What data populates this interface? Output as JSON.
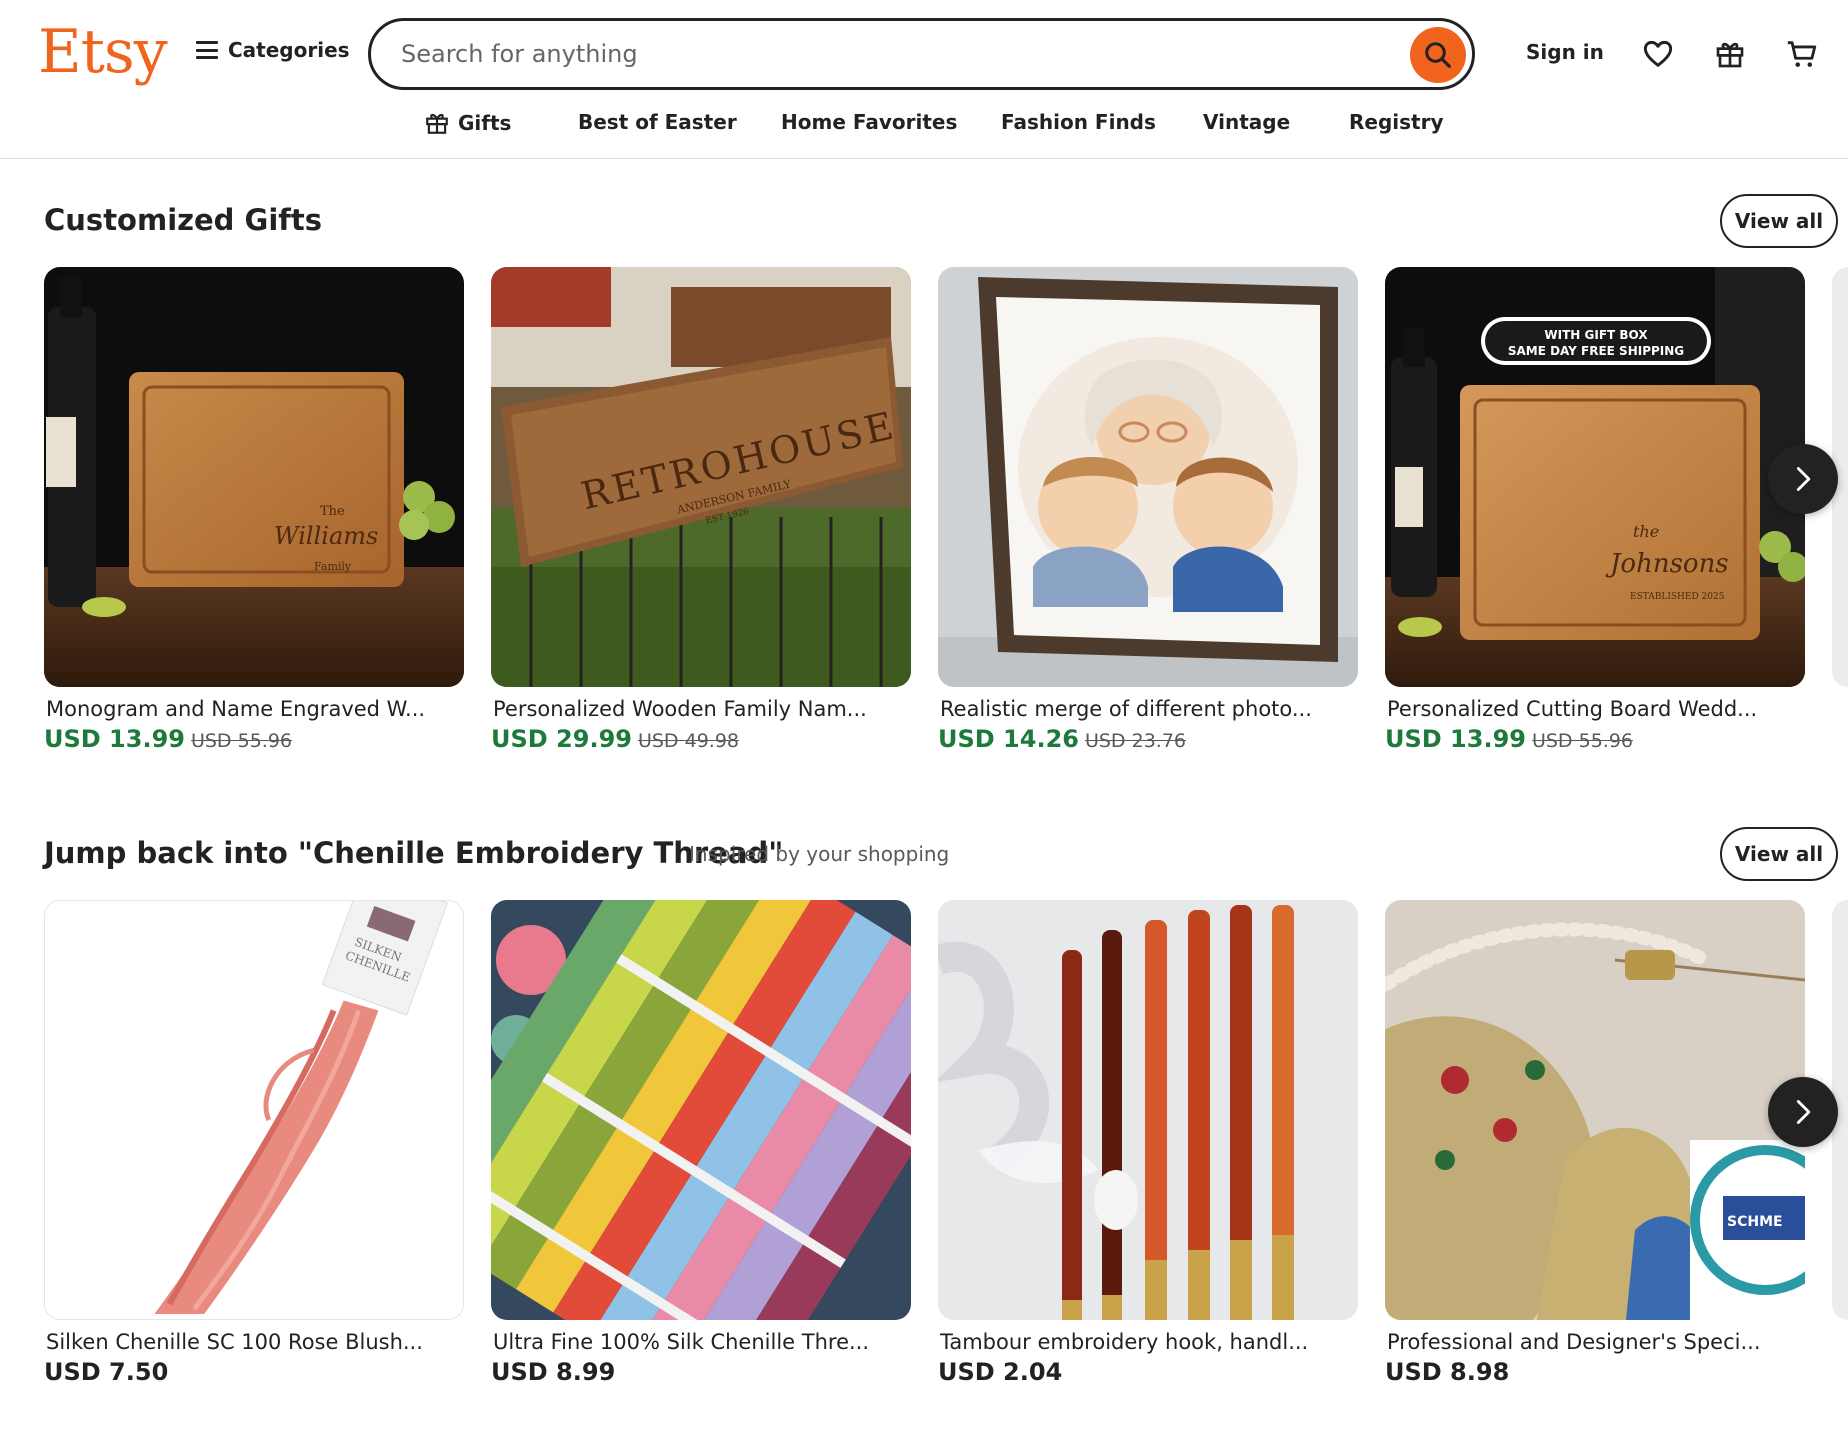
{
  "header": {
    "logo": "Etsy",
    "categories_label": "Categories",
    "search_placeholder": "Search for anything",
    "sign_in": "Sign in"
  },
  "nav": [
    {
      "label": "Gifts"
    },
    {
      "label": "Best of Easter"
    },
    {
      "label": "Home Favorites"
    },
    {
      "label": "Fashion Finds"
    },
    {
      "label": "Vintage"
    },
    {
      "label": "Registry"
    }
  ],
  "section1": {
    "title": "Customized Gifts",
    "view_all": "View all",
    "items": [
      {
        "title": "Monogram and Name Engraved W...",
        "price": "USD 13.99",
        "old_price": "USD 55.96",
        "image_text": [
          "The",
          "Williams",
          "Family"
        ]
      },
      {
        "title": "Personalized Wooden Family Nam...",
        "price": "USD 29.99",
        "old_price": "USD 49.98",
        "image_text": [
          "RETROHOUSE",
          "ANDERSON FAMILY",
          "EST 1926"
        ]
      },
      {
        "title": "Realistic merge of different photo...",
        "price": "USD 14.26",
        "old_price": "USD 23.76"
      },
      {
        "title": "Personalized Cutting Board Wedd...",
        "price": "USD 13.99",
        "old_price": "USD 55.96",
        "image_text": [
          "WITH GIFT BOX",
          "SAME DAY FREE SHIPPING",
          "the",
          "Johnsons",
          "ESTABLISHED 2025"
        ]
      }
    ]
  },
  "section2": {
    "title": "Jump back into \"Chenille Embroidery Thread\"",
    "subtitle": "Inspired by your shopping",
    "view_all": "View all",
    "items": [
      {
        "title": "Silken Chenille SC 100 Rose Blush...",
        "price": "USD 7.50",
        "image_text": [
          "SILKEN",
          "CHENILLE"
        ]
      },
      {
        "title": "Ultra Fine 100% Silk Chenille Thre...",
        "price": "USD 8.99"
      },
      {
        "title": "Tambour embroidery hook, handl...",
        "price": "USD 2.04"
      },
      {
        "title": "Professional and Designer's Speci...",
        "price": "USD 8.98",
        "image_text": [
          "SCHME"
        ]
      }
    ]
  },
  "colors": {
    "brand": "#f1641e",
    "sale_price": "#1d7a3a",
    "text": "#222222",
    "muted": "#595959"
  },
  "icons": [
    "menu-icon",
    "search-icon",
    "heart-icon",
    "gift-icon",
    "cart-icon",
    "chevron-right-icon"
  ]
}
